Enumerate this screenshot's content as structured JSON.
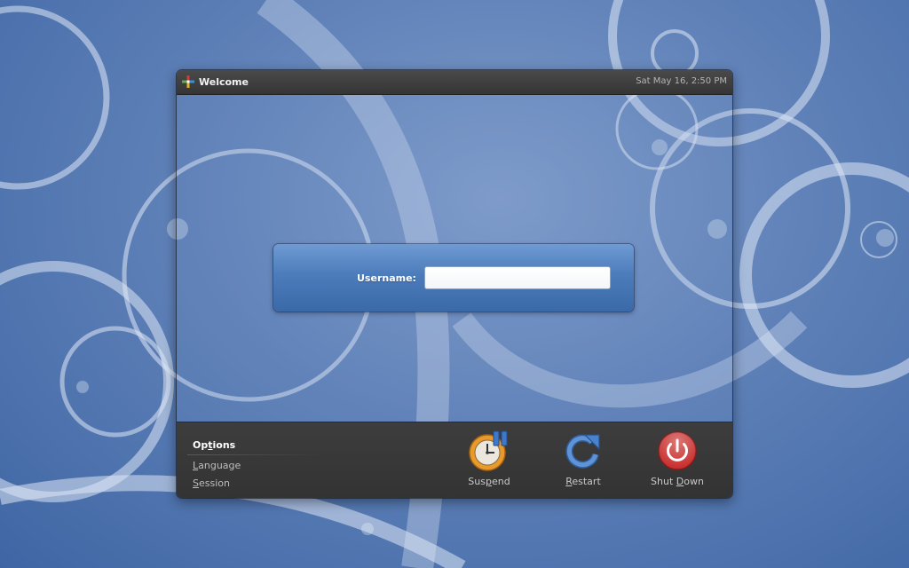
{
  "window": {
    "title": "Welcome",
    "clock": "Sat May 16,  2:50 PM"
  },
  "login": {
    "username_label": "Username:",
    "username_value": "",
    "username_placeholder": ""
  },
  "options_menu": {
    "items": [
      {
        "pre": "Op",
        "mnemonic": "t",
        "post": "ions"
      },
      {
        "pre": "",
        "mnemonic": "L",
        "post": "anguage"
      },
      {
        "pre": "",
        "mnemonic": "S",
        "post": "ession"
      }
    ]
  },
  "actions": {
    "suspend": {
      "pre": "Sus",
      "mnemonic": "p",
      "post": "end",
      "icon": "suspend-icon"
    },
    "restart": {
      "pre": "",
      "mnemonic": "R",
      "post": "estart",
      "icon": "restart-icon"
    },
    "shutdown": {
      "pre": "Shut ",
      "mnemonic": "D",
      "post": "own",
      "icon": "power-icon"
    }
  },
  "colors": {
    "login_panel": "#4c7cbb",
    "bottom_bar": "#383838",
    "shutdown_red": "#c8302e",
    "suspend_orange": "#e89a2c"
  }
}
